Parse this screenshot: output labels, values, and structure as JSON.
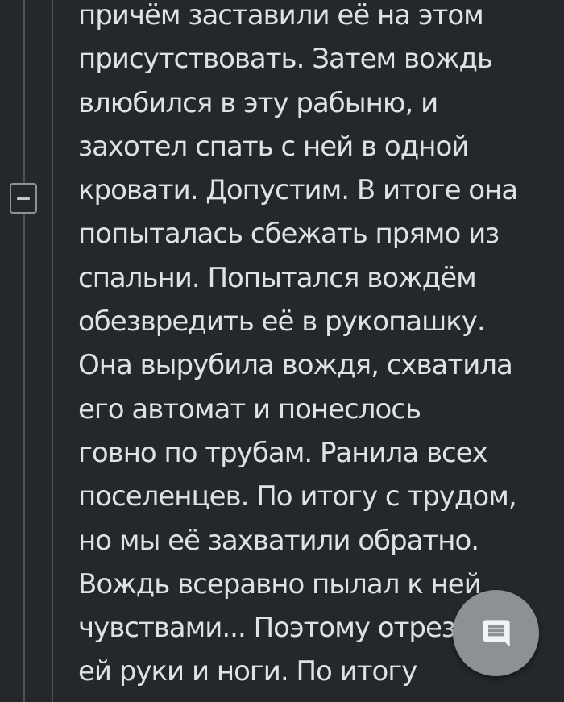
{
  "comment": {
    "lines": [
      "причём заставили её на этом",
      "присутствовать. Затем вождь",
      "влюбился в эту рабыню, и",
      "захотел спать с ней в одной",
      "кровати. Допустим. В итоге она",
      "попыталась сбежать прямо из",
      "спальни. Попытался вождём",
      "обезвредить её в рукопашку.",
      "Она вырубила вождя, схватила",
      "его автомат и понеслось",
      "говно по трубам. Ранила всех",
      "поселенцев. По итогу с трудом,",
      "но мы её захватили обратно.",
      "Вождь всеравно пылал к ней",
      "чувствами... Поэтому отрезал",
      "ей руки и ноги. По итогу"
    ]
  },
  "collapse_toggle": {
    "icon": "minus-icon"
  },
  "fab": {
    "icon": "comment-icon"
  },
  "colors": {
    "background": "#25282b",
    "text": "#dfe1e3",
    "thread_line": "#4d5156",
    "fab": "#8c9196"
  }
}
